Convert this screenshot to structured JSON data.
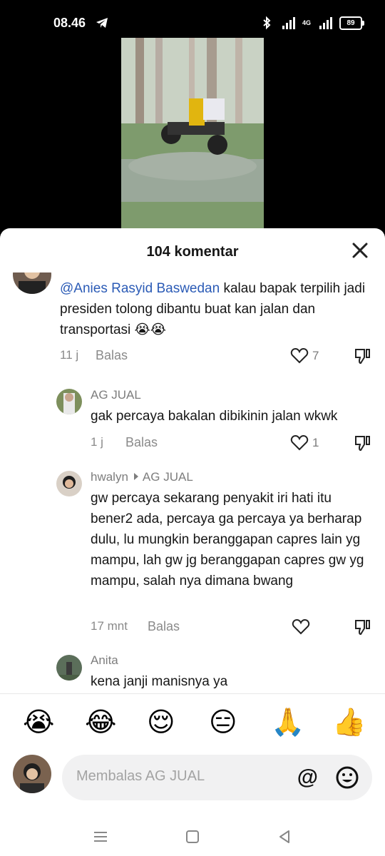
{
  "status_bar": {
    "time": "08.46",
    "network": "4G",
    "battery": "89"
  },
  "video": {
    "icon": "video-thumbnail"
  },
  "sheet": {
    "title": "104 komentar",
    "close_icon": "close-icon"
  },
  "comments": [
    {
      "mention": "@Anies Rasyid Baswedan",
      "text": " kalau bapak terpilih jadi presiden tolong dibantu buat kan jalan dan transportasi 😭😭",
      "time": "11 j",
      "reply_label": "Balas",
      "likes": "7"
    },
    {
      "author": "AG JUAL",
      "text": "gak percaya bakalan dibikinin jalan wkwk",
      "time": "1 j",
      "reply_label": "Balas",
      "likes": "1"
    },
    {
      "author": "hwalyn",
      "reply_to": "AG JUAL",
      "text": "gw percaya sekarang penyakit iri hati itu bener2 ada, percaya ga percaya ya berharap dulu, lu mungkin beranggapan capres lain yg mampu, lah gw jg beranggapan capres gw yg mampu, salah nya dimana bwang",
      "time": "17 mnt",
      "reply_label": "Balas",
      "likes": ""
    },
    {
      "author": "Anita",
      "text": "kena janji manisnya ya"
    }
  ],
  "emoji_bar": [
    "😭",
    "😂",
    "😌",
    "😑",
    "🙏",
    "👍"
  ],
  "compose": {
    "placeholder": "Membalas AG JUAL",
    "at_symbol": "@",
    "emoji_icon": "smile-icon"
  },
  "nav": [
    "menu-icon",
    "home-icon",
    "back-icon"
  ],
  "colors": {
    "mention": "#2b5bb6",
    "muted": "#8a8a8a",
    "text": "#161616"
  }
}
